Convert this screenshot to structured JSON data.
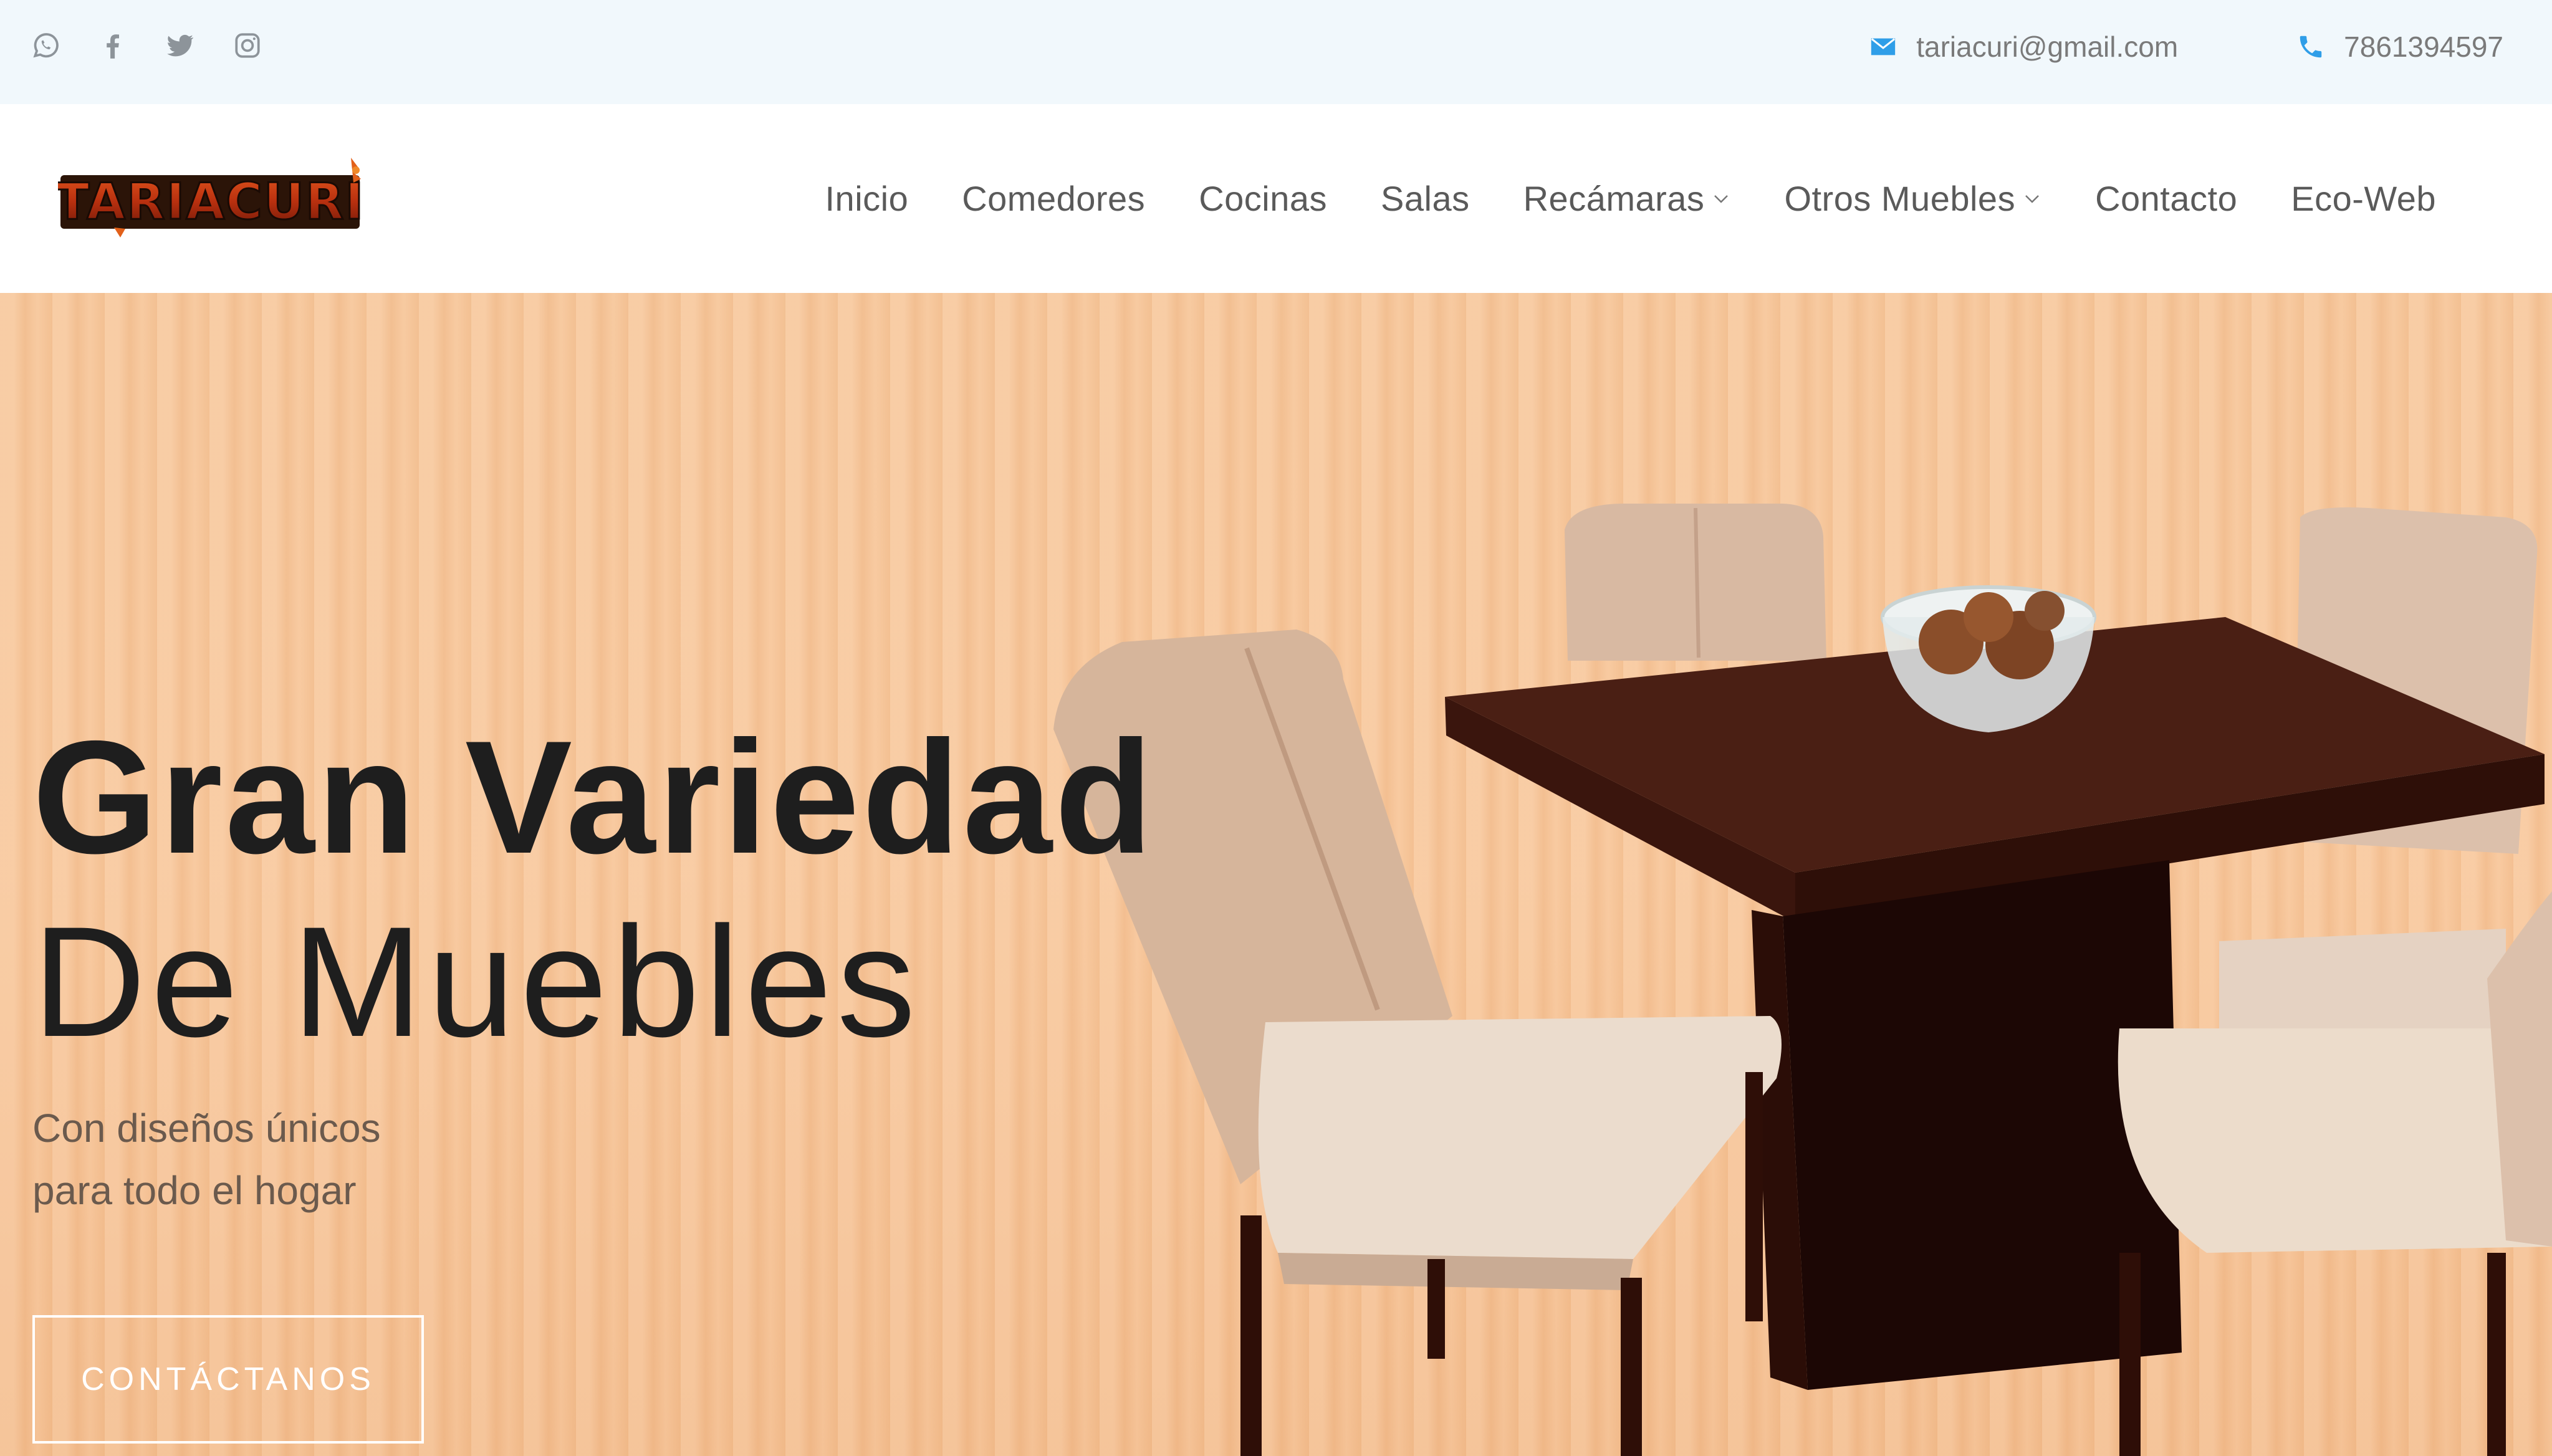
{
  "topbar": {
    "social_icons": [
      "whatsapp-icon",
      "facebook-icon",
      "twitter-icon",
      "instagram-icon"
    ],
    "email": "tariacuri@gmail.com",
    "phone": "7861394597"
  },
  "header": {
    "logo_text": "TARIACURI",
    "nav": [
      {
        "label": "Inicio"
      },
      {
        "label": "Comedores"
      },
      {
        "label": "Cocinas"
      },
      {
        "label": "Salas"
      },
      {
        "label": "Recámaras",
        "has_dropdown": true
      },
      {
        "label": "Otros Muebles",
        "has_dropdown": true
      },
      {
        "label": "Contacto"
      },
      {
        "label": "Eco-Web"
      }
    ]
  },
  "hero": {
    "title_line1": "Gran Variedad",
    "title_line2": "De Muebles",
    "subtitle_line1": "Con diseños únicos",
    "subtitle_line2": "para todo el hogar",
    "cta_label": "CONTÁCTANOS"
  },
  "colors": {
    "topbar_bg": "#f1f8fc",
    "icon_blue": "#2f9ee8",
    "hero_bg": "#f7c79b",
    "title": "#1e1e1e"
  }
}
